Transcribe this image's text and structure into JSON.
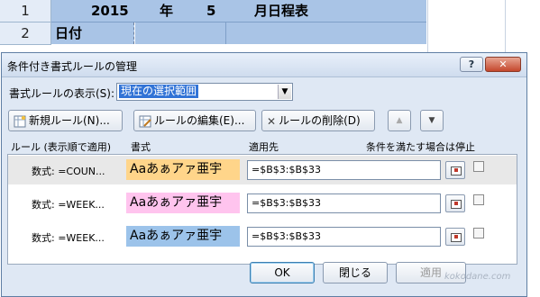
{
  "sheet": {
    "row1": "1",
    "row2": "2",
    "title_parts": [
      "2015",
      "年",
      "5",
      "月日程表"
    ],
    "date_label": "日付"
  },
  "dialog": {
    "title": "条件付き書式ルールの管理",
    "help_label": "?",
    "close_label": "✕",
    "show_label": "書式ルールの表示(S):",
    "show_value": "現在の選択範囲",
    "new_rule": "新規ルール(N)...",
    "edit_rule": "ルールの編集(E)...",
    "delete_rule": "ルールの削除(D)",
    "headers": {
      "rule": "ルール (表示順で適用)",
      "format": "書式",
      "applies_to": "適用先",
      "stop_if_true": "条件を満たす場合は停止"
    },
    "rules": [
      {
        "name": "数式: =COUN...",
        "preview": "Aaあぁアァ亜宇",
        "color": "#ffd58a",
        "applies": "=$B$3:$B$33",
        "stop": false
      },
      {
        "name": "数式: =WEEK...",
        "preview": "Aaあぁアァ亜宇",
        "color": "#ffc4ee",
        "applies": "=$B$3:$B$33",
        "stop": false
      },
      {
        "name": "数式: =WEEK...",
        "preview": "Aaあぁアァ亜宇",
        "color": "#9cc3ea",
        "applies": "=$B$3:$B$33",
        "stop": false
      }
    ],
    "ok": "OK",
    "close": "閉じる",
    "apply": "適用"
  },
  "watermark": "kokodane.com"
}
